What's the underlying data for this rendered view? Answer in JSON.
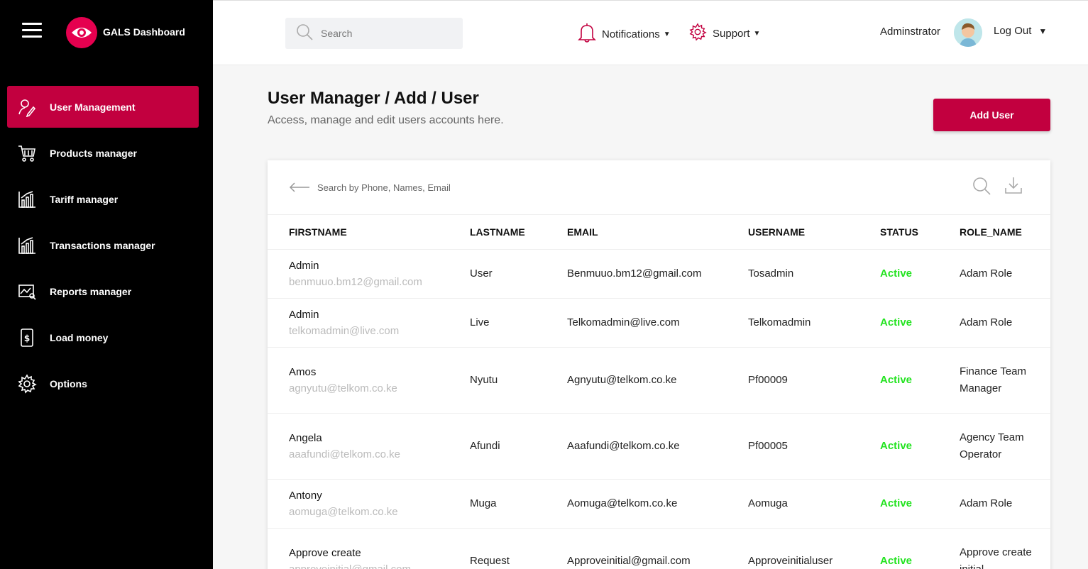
{
  "app": {
    "brand": "GALS Dashboard"
  },
  "sidebar": {
    "items": [
      {
        "label": "User Management",
        "icon": "user-edit-icon",
        "active": true
      },
      {
        "label": "Products manager",
        "icon": "cart-icon"
      },
      {
        "label": "Tariff manager",
        "icon": "bar-chart-icon"
      },
      {
        "label": "Transactions manager",
        "icon": "bar-chart-icon"
      },
      {
        "label": "Reports manager",
        "icon": "report-icon"
      },
      {
        "label": "Load money",
        "icon": "money-icon"
      },
      {
        "label": "Options",
        "icon": "gear-icon"
      }
    ]
  },
  "topbar": {
    "search_placeholder": "Search",
    "notifications": "Notifications",
    "support": "Support",
    "user_name": "Adminstrator",
    "logout": "Log Out"
  },
  "main": {
    "title": "User Manager / Add / User",
    "subtitle": "Access, manage and edit users accounts here.",
    "add_button": "Add User",
    "table_search_placeholder": "Search by Phone, Names, Email",
    "columns": [
      "FIRSTNAME",
      "LASTNAME",
      "EMAIL",
      "USERNAME",
      "STATUS",
      "ROLE_NAME"
    ],
    "rows": [
      {
        "first": "Admin",
        "sub_email": "benmuuo.bm12@gmail.com",
        "last": "User",
        "email": "Benmuuo.bm12@gmail.com",
        "username": "Tosadmin",
        "status": "Active",
        "role": "Adam Role"
      },
      {
        "first": "Admin",
        "sub_email": "telkomadmin@live.com",
        "last": "Live",
        "email": "Telkomadmin@live.com",
        "username": "Telkomadmin",
        "status": "Active",
        "role": "Adam Role"
      },
      {
        "first": "Amos",
        "sub_email": "agnyutu@telkom.co.ke",
        "last": "Nyutu",
        "email": "Agnyutu@telkom.co.ke",
        "username": "Pf00009",
        "status": "Active",
        "role": "Finance Team Manager"
      },
      {
        "first": "Angela",
        "sub_email": "aaafundi@telkom.co.ke",
        "last": "Afundi",
        "email": "Aaafundi@telkom.co.ke",
        "username": "Pf00005",
        "status": "Active",
        "role": "Agency Team Operator"
      },
      {
        "first": "Antony",
        "sub_email": "aomuga@telkom.co.ke",
        "last": "Muga",
        "email": "Aomuga@telkom.co.ke",
        "username": "Aomuga",
        "status": "Active",
        "role": "Adam Role"
      },
      {
        "first": "Approve create",
        "sub_email": "approveinitial@gmail.com",
        "last": "Request",
        "email": "Approveinitial@gmail.com",
        "username": "Approveinitialuser",
        "status": "Active",
        "role": "Approve create initial"
      }
    ]
  },
  "colors": {
    "accent": "#c2003f",
    "active_status": "#22e31f",
    "sidebar_bg": "#000000"
  }
}
